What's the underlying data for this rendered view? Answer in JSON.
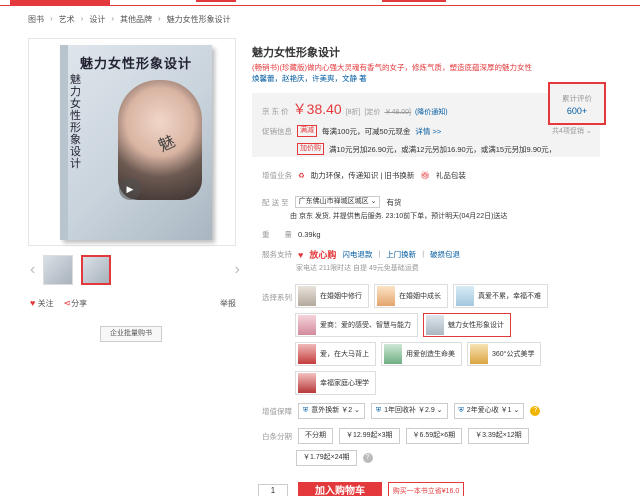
{
  "breadcrumb": [
    "图书",
    "艺术",
    "设计",
    "其他品牌",
    "魅力女性形象设计"
  ],
  "book_cover": {
    "title": "魅力女性形象设计",
    "vertical_title": "魅力女性形象设计",
    "signature": "魅"
  },
  "actions": {
    "follow": "关注",
    "share": "分享",
    "report": "举报",
    "bulk_buy": "企业批量购书"
  },
  "product": {
    "title": "魅力女性形象设计",
    "slogan_part1": "(畅销书)(珍藏版)做内心强大灵魂有香气的女子，修炼气质，塑造底蕴深厚的魅力女性",
    "slogan_authors": "焕馨蕾，赵艳庆，许美爽，文静 著"
  },
  "price": {
    "label": "京 东 价",
    "value": "￥38.40",
    "discount": "[8折]",
    "list_label": "[定价",
    "list_value": "￥48.00]",
    "notice": "(降价通知)"
  },
  "promo": {
    "label": "促销信息",
    "tag1": "满减",
    "text1": "每满100元，可减50元现金",
    "detail": "详情 >>",
    "tag2": "加价购",
    "text2": "满10元另加26.90元，或满12元另加16.90元，或满15元另加9.90元，",
    "more": "共4项促销 ⌄"
  },
  "review": {
    "label": "累计评价",
    "count": "600+"
  },
  "services_row": {
    "label": "增值业务",
    "item1": "助力环保，传递知识 | 旧书换新",
    "item2": "礼品包装"
  },
  "delivery": {
    "label": "配 送 至",
    "region": "广东佛山市禅城区城区 ⌄",
    "stock": "有货",
    "note": "由 京东 发货, 并提供售后服务. 23:10前下单，预计明天(04月22日)送达"
  },
  "weight": {
    "label": "重　　量",
    "value": "0.39kg"
  },
  "support": {
    "label": "服务支持",
    "brand": "放心购",
    "items": [
      "闪电退款",
      "上门换新",
      "破损包退"
    ],
    "sub": "家电达 211限时达 自提 49元免基础运费"
  },
  "series": {
    "label": "选择系列",
    "options": [
      "在婚姻中修行",
      "在婚姻中成长",
      "真爱不累，幸福不难",
      "爱商：爱的感受、智慧与能力",
      "魅力女性形象设计",
      "爱，在大马背上",
      "用爱创造生命美",
      "360°公式美学",
      "幸福家庭心理学"
    ]
  },
  "warranty": {
    "label": "增值保障",
    "items": [
      "意外换新 ￥2 ⌄",
      "1年回收补 ￥2.9 ⌄",
      "2年爱心收 ￥1 ⌄"
    ],
    "help": "?"
  },
  "installment": {
    "label": "白条分期",
    "items": [
      "不分期",
      "￥12.99起×3期",
      "￥6.59起×6期",
      "￥3.39起×12期",
      "￥1.79起×24期"
    ],
    "help": "?"
  },
  "buy": {
    "qty": "1",
    "buy_label": "加入购物车",
    "cart_label": "购买一本书立省¥16.0"
  }
}
